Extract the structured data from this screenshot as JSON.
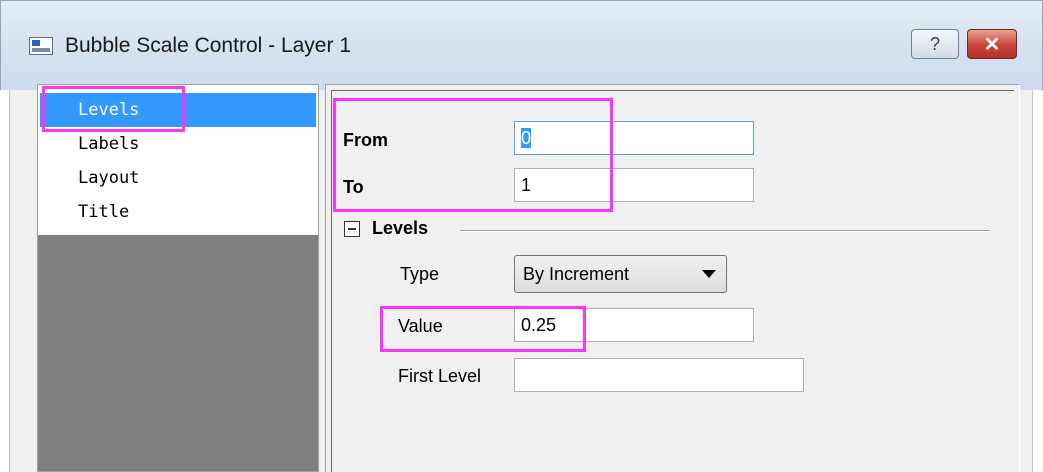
{
  "window": {
    "title": "Bubble Scale Control - Layer 1",
    "help_label": "?",
    "close_label": "✕"
  },
  "tree": {
    "items": [
      {
        "label": "Levels",
        "selected": true
      },
      {
        "label": "Labels",
        "selected": false
      },
      {
        "label": "Layout",
        "selected": false
      },
      {
        "label": "Title",
        "selected": false
      }
    ]
  },
  "form": {
    "from_label": "From",
    "from_value": "0",
    "to_label": "To",
    "to_value": "1",
    "levels_group_label": "Levels",
    "type_label": "Type",
    "type_value": "By Increment",
    "value_label": "Value",
    "value_value": "0.25",
    "first_level_label": "First Level",
    "first_level_value": ""
  },
  "colors": {
    "highlight": "#ff33ff",
    "selection": "#3399ff",
    "close_button": "#c9453a"
  }
}
